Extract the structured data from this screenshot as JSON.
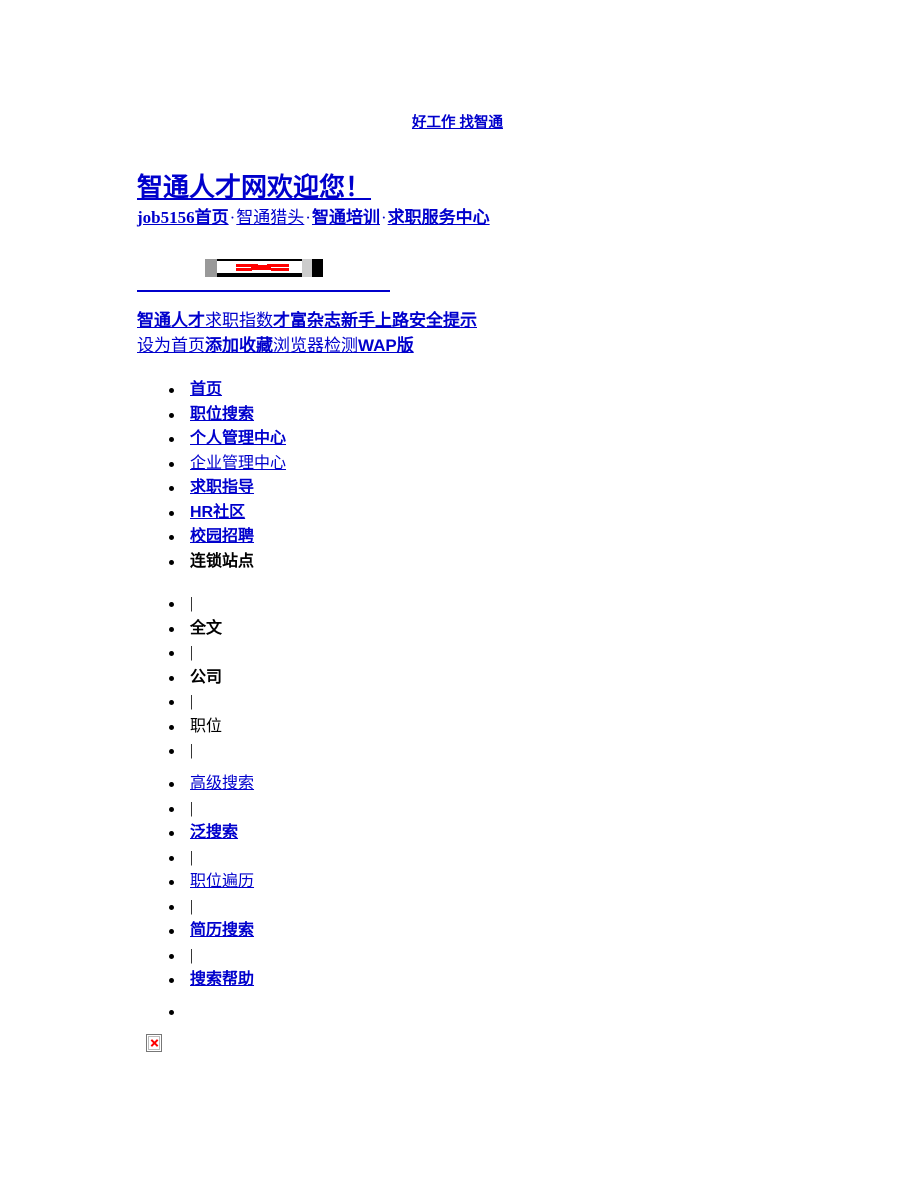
{
  "header": {
    "tagline": "好工作 找智通",
    "welcome_title": "智通人才网欢迎您！"
  },
  "channel_links": {
    "separator": "·",
    "items": [
      {
        "label": "job5156首页",
        "style": "bold"
      },
      {
        "label": "智通猎头",
        "style": "mixed"
      },
      {
        "label": "智通培训",
        "style": "bold"
      },
      {
        "label": "求职服务中心",
        "style": "bold"
      }
    ]
  },
  "banner": {
    "alt_graphic": "broken-banner-image"
  },
  "sub_links": {
    "row1": [
      {
        "label": "智通人才",
        "style": "bold"
      },
      {
        "label": "求职指数",
        "style": "thin"
      },
      {
        "label": "才富杂志",
        "style": "bold"
      },
      {
        "label": "新手上路",
        "style": "bold"
      },
      {
        "label": "安全提示",
        "style": "bold"
      }
    ],
    "row2": [
      {
        "label": "设为首页",
        "style": "thin"
      },
      {
        "label": "添加收藏",
        "style": "bold"
      },
      {
        "label": "浏览器检测",
        "style": "thin"
      },
      {
        "label": "WAP版",
        "style": "bold"
      }
    ]
  },
  "nav_main": [
    {
      "label": "首页",
      "is_link": true
    },
    {
      "label": "职位搜索",
      "is_link": true
    },
    {
      "label": "个人管理中心",
      "is_link": true
    },
    {
      "label": "企业管理中心",
      "is_link": true
    },
    {
      "label": "求职指导",
      "is_link": true
    },
    {
      "label": "HR社区",
      "is_link": true
    },
    {
      "label": "校园招聘",
      "is_link": true
    },
    {
      "label": " 连锁站点",
      "is_link": false
    }
  ],
  "nav_scope": [
    {
      "label": "|",
      "is_link": false,
      "is_pipe": true
    },
    {
      "label": "全文",
      "is_link": false
    },
    {
      "label": "|",
      "is_link": false,
      "is_pipe": true
    },
    {
      "label": "公司",
      "is_link": false
    },
    {
      "label": "|",
      "is_link": false,
      "is_pipe": true
    },
    {
      "label": "职位",
      "is_link": false
    },
    {
      "label": "|",
      "is_link": false,
      "is_pipe": true
    }
  ],
  "nav_tools": [
    {
      "label": "高级搜索",
      "is_link": true
    },
    {
      "label": "|",
      "is_link": false,
      "is_pipe": true
    },
    {
      "label": "泛搜索",
      "is_link": true
    },
    {
      "label": "|",
      "is_link": false,
      "is_pipe": true
    },
    {
      "label": "职位遍历",
      "is_link": true
    },
    {
      "label": "|",
      "is_link": false,
      "is_pipe": true
    },
    {
      "label": "简历搜索",
      "is_link": true
    },
    {
      "label": "|",
      "is_link": false,
      "is_pipe": true
    },
    {
      "label": "搜索帮助",
      "is_link": true
    }
  ],
  "nav_trail": [
    {
      "label": "",
      "is_link": false
    }
  ],
  "colors": {
    "link": "#0000CC",
    "text": "#000000",
    "background": "#FFFFFF",
    "broken_mark": "#FF0000"
  }
}
